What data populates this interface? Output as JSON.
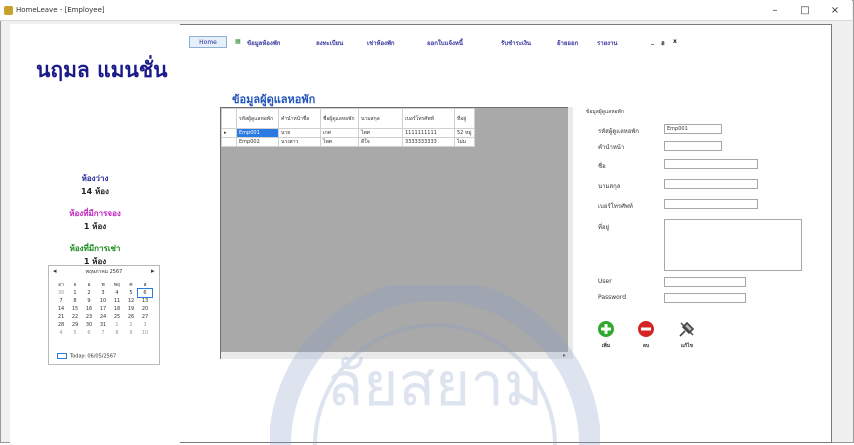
{
  "window": {
    "title": "HomeLeave - [Employee]",
    "controls": [
      "–",
      "□",
      "×"
    ]
  },
  "sidebar": {
    "hotel_name": "นฤมล แมนชั่น",
    "stats": [
      {
        "label": "ห้องว่าง",
        "value": "14 ห้อง",
        "color": "#2a2aa0"
      },
      {
        "label": "ห้องที่มีการจอง",
        "value": "1 ห้อง",
        "color": "#c021c0"
      },
      {
        "label": "ห้องที่มีการเช่า",
        "value": "1 ห้อง",
        "color": "#1a8a1a"
      }
    ],
    "calendar": {
      "month_label": "พฤษภาคม 2567",
      "weekdays": [
        "อา",
        "จ",
        "อ",
        "พ",
        "พฤ",
        "ศ",
        "ส"
      ],
      "weeks": [
        [
          "30",
          "1",
          "2",
          "3",
          "4",
          "5",
          "6"
        ],
        [
          "7",
          "8",
          "9",
          "10",
          "11",
          "12",
          "13"
        ],
        [
          "14",
          "15",
          "16",
          "17",
          "18",
          "19",
          "20"
        ],
        [
          "21",
          "22",
          "23",
          "24",
          "25",
          "26",
          "27"
        ],
        [
          "28",
          "29",
          "30",
          "31",
          "1",
          "2",
          "3"
        ],
        [
          "4",
          "5",
          "6",
          "7",
          "8",
          "9",
          "10"
        ]
      ],
      "selected_day": "6",
      "today_label": "Today: 06/05/2567"
    }
  },
  "menubar": {
    "home": "Home",
    "items": [
      "ข้อมูลห้องพัก",
      "ลงทะเบียน",
      "เช่าห้องพัก",
      "ออกใบแจ้งหนี้",
      "รับชำระเงิน",
      "ย้ายออก",
      "รายงาน"
    ],
    "mdi_controls": [
      "_",
      "ฮ",
      "x"
    ]
  },
  "form": {
    "title": "ข้อมูลผู้ดูแลหอพัก",
    "grid": {
      "columns": [
        "รหัสผู้ดูแลหอพัก",
        "คำนำหน้าชื่อ",
        "ชื่อผู้ดูแลหอพัก",
        "นามสกุล",
        "เบอร์โทรศัพท์",
        "ที่อยู่"
      ],
      "rows": [
        [
          "Emp001",
          "นาย",
          "เกศ",
          "ไพศ",
          "1111111111",
          "52 หมู่"
        ],
        [
          "Emp002",
          "นางสาว",
          "ไพศ",
          "ดีใจ",
          "3333333333",
          "ไม่ม"
        ]
      ],
      "selected_row": 0
    },
    "detail": {
      "group_title": "ข้อมูลผู้ดูแลหอพัก",
      "fields": [
        {
          "label": "รหัสผู้ดูแลหอพัก",
          "value": "Emp001"
        },
        {
          "label": "คำนำหน้า",
          "value": ""
        },
        {
          "label": "ชื่อ",
          "value": ""
        },
        {
          "label": "นามสกุล",
          "value": ""
        },
        {
          "label": "เบอร์โทรศัพท์",
          "value": ""
        },
        {
          "label": "ที่อยู่",
          "value": ""
        },
        {
          "label": "User",
          "value": ""
        },
        {
          "label": "Password",
          "value": ""
        }
      ]
    },
    "actions": [
      {
        "label": "เพิ่ม",
        "icon": "add-icon",
        "color": "#2ea82e"
      },
      {
        "label": "ลบ",
        "icon": "delete-icon",
        "color": "#d42424"
      },
      {
        "label": "แก้ไข",
        "icon": "edit-icon",
        "color": "#444444"
      }
    ]
  }
}
